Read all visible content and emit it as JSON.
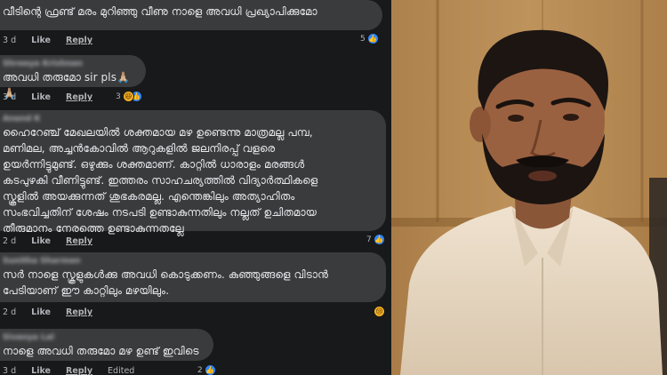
{
  "comments": [
    {
      "author": "",
      "text": "വീടിന്റെ ഫ്രണ്ട് മരം മുറിഞ്ഞു വീണു നാളെ അവധി പ്രഖ്യാപിക്കുമോ",
      "time": "3 d",
      "like": "Like",
      "reply": "Reply",
      "edited": "",
      "reaction_count": "5",
      "reactions": [
        "like-icon"
      ]
    },
    {
      "author": "Shreeya Krishnan",
      "text": "അവധി തരുമോ sir pls🙏🏼🙏🏼",
      "time": "3 d",
      "like": "Like",
      "reply": "Reply",
      "edited": "",
      "reaction_count": "3",
      "reactions": [
        "haha-icon",
        "like-icon"
      ]
    },
    {
      "author": "Anand K",
      "text": "ഹൈറേഞ്ച് മേഖലയിൽ ശക്തമായ മഴ ഉണ്ടെന്നു മാത്രമല്ല പമ്പ,\nമണിമല, അച്ചൻകോവിൽ ആറുകളിൽ ജലനിരപ്പ് വളരെ\nഉയർന്നിട്ടുമുണ്ട്. ഒഴുക്കും ശക്തമാണ്. കാറ്റിൽ ധാരാളം മരങ്ങൾ\nകടപുഴകി വീണിട്ടുണ്ട്. ഇത്തരം സാഹചര്യത്തിൽ വിദ്യാർത്ഥികളെ\nസ്കൂളിൽ അയക്കുന്നത് ശുഭകരമല്ല. എന്തെങ്കിലും അത്യാഹിതം\nസംഭവിച്ചതിന് ശേഷം നടപടി ഉണ്ടാകുന്നതിലും നല്ലത് ഉചിതമായ\nതീരുമാനം നേരത്തെ ഉണ്ടാകുന്നതല്ലേ",
      "time": "2 d",
      "like": "Like",
      "reply": "Reply",
      "edited": "",
      "reaction_count": "7",
      "reactions": [
        "like-icon"
      ]
    },
    {
      "author": "Sunitha Sharmen",
      "text": "സർ നാളെ സ്കൂളുകൾക്കു അവധി കൊടുക്കണം. കുഞ്ഞുങ്ങളെ വിടാൻ\nപേടിയാണ് ഈ കാറ്റിലും മഴയിലും.",
      "time": "2 d",
      "like": "Like",
      "reply": "Reply",
      "edited": "",
      "reaction_count": "",
      "reactions": [
        "sad-icon"
      ]
    },
    {
      "author": "Sivanya Lal",
      "text": "നാളെ അവധി തരുമോ മഴ ഉണ്ട് ഇവിടെ",
      "time": "3 d",
      "like": "Like",
      "reply": "Reply",
      "edited": "Edited",
      "reaction_count": "2",
      "reactions": [
        "like-icon"
      ]
    }
  ],
  "colors": {
    "background": "#18191a",
    "bubble": "#3a3b3c",
    "text": "#e4e6eb",
    "meta_text": "#b0b3b8",
    "like_blue": "#2d88ff",
    "emoji_yellow": "#f7b125",
    "wall": "#b58a56",
    "shirt": "#ead9c3"
  },
  "photo": {
    "description_icon": "man-portrait"
  }
}
